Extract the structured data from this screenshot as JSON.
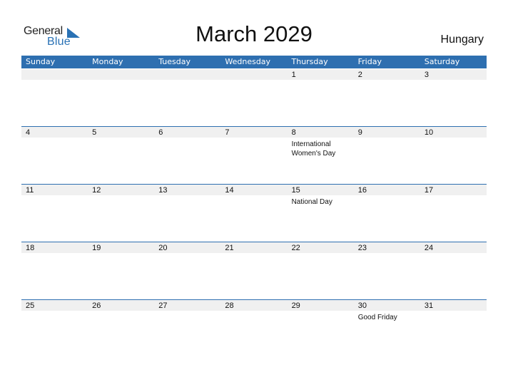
{
  "logo": {
    "part1": "General",
    "part2": "Blue"
  },
  "title": "March 2029",
  "country": "Hungary",
  "colors": {
    "accent": "#2e6fb0",
    "band": "#f0f0f0"
  },
  "weekdays": [
    "Sunday",
    "Monday",
    "Tuesday",
    "Wednesday",
    "Thursday",
    "Friday",
    "Saturday"
  ],
  "weeks": [
    [
      {
        "day": ""
      },
      {
        "day": ""
      },
      {
        "day": ""
      },
      {
        "day": ""
      },
      {
        "day": "1"
      },
      {
        "day": "2"
      },
      {
        "day": "3"
      }
    ],
    [
      {
        "day": "4"
      },
      {
        "day": "5"
      },
      {
        "day": "6"
      },
      {
        "day": "7"
      },
      {
        "day": "8",
        "event": "International Women's Day"
      },
      {
        "day": "9"
      },
      {
        "day": "10"
      }
    ],
    [
      {
        "day": "11"
      },
      {
        "day": "12"
      },
      {
        "day": "13"
      },
      {
        "day": "14"
      },
      {
        "day": "15",
        "event": "National Day"
      },
      {
        "day": "16"
      },
      {
        "day": "17"
      }
    ],
    [
      {
        "day": "18"
      },
      {
        "day": "19"
      },
      {
        "day": "20"
      },
      {
        "day": "21"
      },
      {
        "day": "22"
      },
      {
        "day": "23"
      },
      {
        "day": "24"
      }
    ],
    [
      {
        "day": "25"
      },
      {
        "day": "26"
      },
      {
        "day": "27"
      },
      {
        "day": "28"
      },
      {
        "day": "29"
      },
      {
        "day": "30",
        "event": "Good Friday"
      },
      {
        "day": "31"
      }
    ]
  ]
}
